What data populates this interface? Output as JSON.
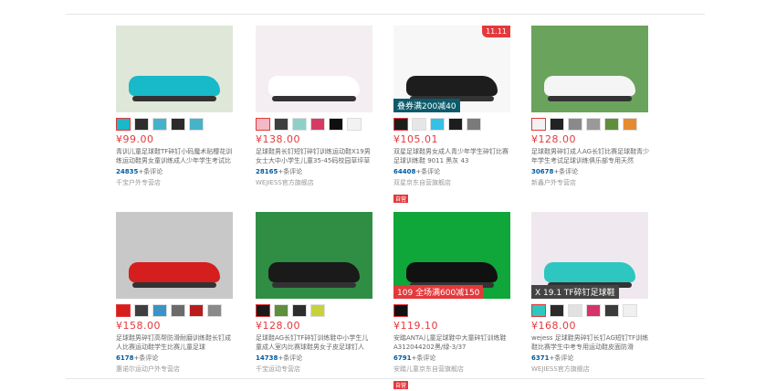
{
  "products": [
    {
      "price": "¥99.00",
      "title": "青训儿童足球鞋TF碎钉小码魔术贴樱花训练运动鞋男女童训练成人少年学生考试比",
      "reviews_count": "24835",
      "reviews_suffix": "+条评论",
      "shop": "千宝户外专营店",
      "badge": "",
      "image_bg": "#dfe8d8",
      "shoe_color": "#18b9c9",
      "thumb_colors": [
        "#18b9c9",
        "#2e2e2e",
        "#44b3c9",
        "#2b2b2b",
        "#48b2c6"
      ]
    },
    {
      "price": "¥138.00",
      "title": "足球鞋男长钉短钉碎钉训练运动鞋X19男女士大中小学生儿童35-45码校园草坪草",
      "reviews_count": "28165",
      "reviews_suffix": "+条评论",
      "shop": "WEJIESS官方旗舰店",
      "badge": "",
      "image_bg": "#f4eef2",
      "shoe_color": "#ffffff",
      "thumb_colors": [
        "#f3b9c6",
        "#3f3f3f",
        "#8cd0c9",
        "#d63b66",
        "#0f0f0f",
        "#f2f2f2"
      ]
    },
    {
      "price": "¥105.01",
      "title": "双星足球鞋男女成人青少年学生碎钉比赛足球训练鞋 9011 黑灰 43",
      "reviews_count": "64408",
      "reviews_suffix": "+条评论",
      "shop": "双星京东自营旗舰店",
      "badge": "自营",
      "corner": "11.11",
      "image_bg": "#f7f7f7",
      "shoe_color": "#1d1d1d",
      "tag_text": "叠券满200减40",
      "tag_bg": "#0c5b6b",
      "thumb_colors": [
        "#1d1d1d",
        "#e6e6e6",
        "#35c0e6",
        "#1d1d1d",
        "#7a7a7a"
      ]
    },
    {
      "price": "¥128.00",
      "title": "足球鞋男碎钉成人AG长钉比赛足球鞋青少年学生考试足球训练俱乐部专用天然",
      "reviews_count": "30678",
      "reviews_suffix": "+条评论",
      "shop": "新鑫户外专营店",
      "badge": "",
      "image_bg": "#6aa35c",
      "shoe_color": "#f5f5f5",
      "thumb_colors": [
        "#f2f2f2",
        "#222222",
        "#8a8a8a",
        "#999999",
        "#5e8f3c",
        "#e58b2f"
      ]
    },
    {
      "price": "¥158.00",
      "title": "足球鞋男碎钉高帮防滑耐磨训练鞋长钉成人比赛运动鞋学生比赛儿童足球",
      "reviews_count": "6178",
      "reviews_suffix": "+条评论",
      "shop": "惠诺尔运动户外专营店",
      "badge": "",
      "image_bg": "#c8c8c8",
      "shoe_color": "#d51e1e",
      "thumb_colors": [
        "#d51e1e",
        "#3f3f3f",
        "#3b93c7",
        "#6b6b6b",
        "#b91c1c",
        "#8a8a8a"
      ]
    },
    {
      "price": "¥128.00",
      "title": "足球鞋AG长钉TF碎钉训练鞋中小学生儿童成人室内比赛球鞋男女子皮足球钉人",
      "reviews_count": "14738",
      "reviews_suffix": "+条评论",
      "shop": "千宝运动专营店",
      "badge": "",
      "image_bg": "#2f8e44",
      "shoe_color": "#1a1a1a",
      "thumb_colors": [
        "#1a1a1a",
        "#5e8f3c",
        "#2e2e2e",
        "#c7d23b"
      ]
    },
    {
      "price": "¥119.10",
      "title": "安踏ANTA儿童足球鞋中大童碎钉训练鞋A312044202黑/绿-3/37",
      "reviews_count": "6791",
      "reviews_suffix": "+条评论",
      "shop": "安踏儿童京东自营旗舰店",
      "badge": "自营",
      "image_bg": "#0fa63a",
      "shoe_color": "#111111",
      "tag_text": "109  全场满600减150",
      "tag_bg": "#e4393c",
      "thumb_colors": [
        "#111111"
      ]
    },
    {
      "price": "¥168.00",
      "title": "wejess 足球鞋男碎钉长钉AG短钉TF训练鞋比赛学生中考专用运动鞋皮面防滑",
      "reviews_count": "6371",
      "reviews_suffix": "+条评论",
      "shop": "WEJIESS官方旗舰店",
      "badge": "",
      "image_bg": "#efe8ef",
      "shoe_color": "#2ec6c0",
      "tag_text": "X 19.1 TF碎钉足球鞋",
      "tag_bg": "#444444",
      "thumb_colors": [
        "#2ec6c0",
        "#2b2b2b",
        "#e1e1e1",
        "#d6336c",
        "#3b3b3b",
        "#f0f0f0"
      ]
    }
  ]
}
